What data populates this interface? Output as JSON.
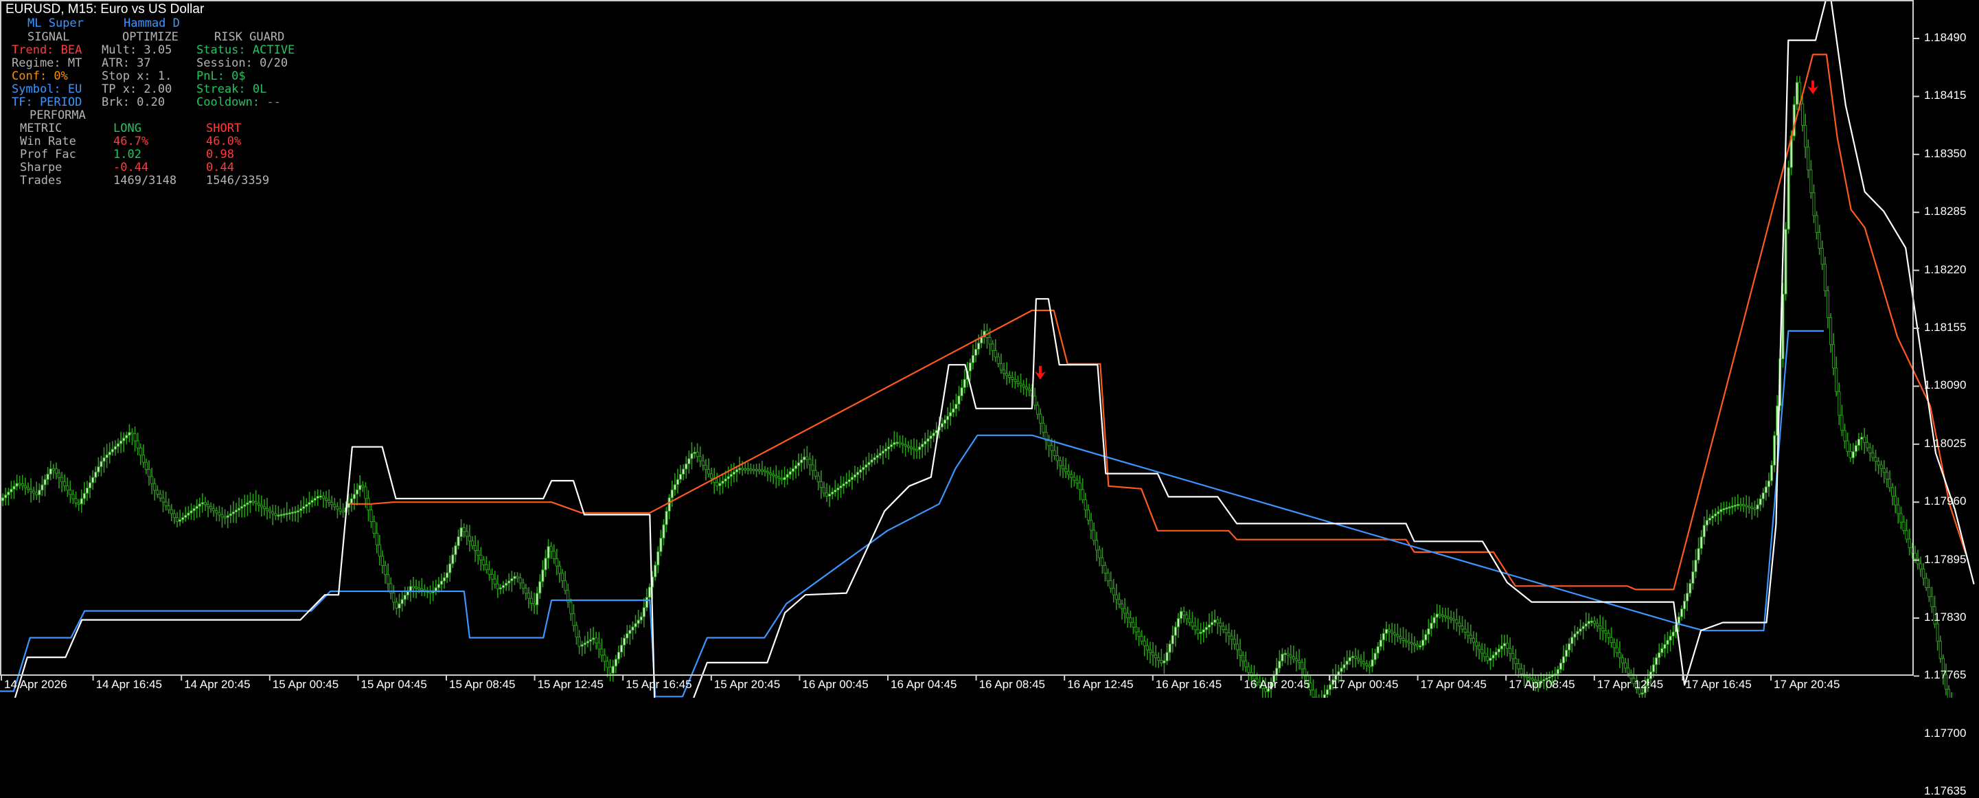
{
  "window": {
    "title": "EURUSD, M15:  Euro vs US Dollar"
  },
  "panel": {
    "header_left": "ML Super",
    "header_right": "Hammad D",
    "sections": [
      "SIGNAL",
      "OPTIMIZE",
      "RISK GUARD"
    ],
    "rows": [
      [
        "Trend: BEA",
        "Mult: 3.05",
        "Status: ACTIVE"
      ],
      [
        "Regime: MT",
        "ATR: 37",
        "Session: 0/20"
      ],
      [
        "Conf: 0%",
        "Stop x: 1.",
        "PnL: 0$"
      ],
      [
        "Symbol: EU",
        "TP x: 2.00",
        "Streak: 0L"
      ],
      [
        "TF: PERIOD",
        "Brk: 0.20",
        "Cooldown: --"
      ]
    ],
    "performance_title": "PERFORMA",
    "metrics_header": [
      "METRIC",
      "LONG",
      "SHORT"
    ],
    "metrics": [
      [
        "Win Rate",
        "46.7%",
        "46.0%"
      ],
      [
        "Prof Fac",
        "1.02",
        "0.98"
      ],
      [
        "Sharpe",
        "-0.44",
        "0.44"
      ],
      [
        "Trades",
        "1469/3148",
        "1546/3359"
      ]
    ]
  },
  "price_axis": [
    "1.18490",
    "1.18415",
    "1.18350",
    "1.18285",
    "1.18220",
    "1.18155",
    "1.18090",
    "1.18025",
    "1.17960",
    "1.17895",
    "1.17830",
    "1.17765",
    "1.17700",
    "1.17635"
  ],
  "time_axis": [
    "14 Apr 2026",
    "14 Apr 16:45",
    "14 Apr 20:45",
    "15 Apr 00:45",
    "15 Apr 04:45",
    "15 Apr 08:45",
    "15 Apr 12:45",
    "15 Apr 16:45",
    "15 Apr 20:45",
    "16 Apr 00:45",
    "16 Apr 04:45",
    "16 Apr 08:45",
    "16 Apr 12:45",
    "16 Apr 16:45",
    "16 Apr 20:45",
    "17 Apr 00:45",
    "17 Apr 04:45",
    "17 Apr 08:45",
    "17 Apr 12:45",
    "17 Apr 16:45",
    "17 Apr 20:45"
  ],
  "colors": {
    "background": "#000000",
    "candle": "#2a9a1a",
    "candle_body": "#c8f0c0",
    "band_white": "#ffffff",
    "band_orange": "#ff5a1e",
    "band_blue": "#3c96ff",
    "signal_arrow": "#ff1010",
    "text_blue": "#3c96ff",
    "text_gray": "#b4b4b4",
    "text_red": "#ff3b3b",
    "text_orange": "#ff8c00",
    "text_green": "#22c55e"
  },
  "series": {
    "price": [
      [
        0,
        1.1797
      ],
      [
        14,
        1.17992
      ],
      [
        28,
        1.17978
      ],
      [
        39,
        1.1801
      ],
      [
        58,
        1.17966
      ],
      [
        76,
        1.18018
      ],
      [
        97,
        1.1805
      ],
      [
        114,
        1.17984
      ],
      [
        131,
        1.17948
      ],
      [
        149,
        1.1797
      ],
      [
        165,
        1.17952
      ],
      [
        185,
        1.17972
      ],
      [
        203,
        1.17955
      ],
      [
        219,
        1.1796
      ],
      [
        235,
        1.17978
      ],
      [
        252,
        1.17958
      ],
      [
        266,
        1.17992
      ],
      [
        279,
        1.1791
      ],
      [
        291,
        1.1785
      ],
      [
        302,
        1.17876
      ],
      [
        317,
        1.17868
      ],
      [
        328,
        1.17888
      ],
      [
        339,
        1.17942
      ],
      [
        353,
        1.17906
      ],
      [
        366,
        1.17872
      ],
      [
        379,
        1.17888
      ],
      [
        392,
        1.17852
      ],
      [
        403,
        1.17922
      ],
      [
        414,
        1.17878
      ],
      [
        425,
        1.17808
      ],
      [
        436,
        1.17818
      ],
      [
        448,
        1.17778
      ],
      [
        459,
        1.1782
      ],
      [
        471,
        1.17842
      ],
      [
        480,
        1.17892
      ],
      [
        492,
        1.1798
      ],
      [
        509,
        1.18028
      ],
      [
        526,
        1.17988
      ],
      [
        542,
        1.18008
      ],
      [
        559,
        1.18006
      ],
      [
        574,
        1.17995
      ],
      [
        591,
        1.18022
      ],
      [
        606,
        1.17976
      ],
      [
        623,
        1.17995
      ],
      [
        640,
        1.18018
      ],
      [
        657,
        1.18038
      ],
      [
        672,
        1.18028
      ],
      [
        688,
        1.18052
      ],
      [
        701,
        1.18078
      ],
      [
        713,
        1.18132
      ],
      [
        722,
        1.18162
      ],
      [
        735,
        1.18116
      ],
      [
        746,
        1.18104
      ],
      [
        756,
        1.18094
      ],
      [
        767,
        1.1804
      ],
      [
        778,
        1.1801
      ],
      [
        791,
        1.1799
      ],
      [
        804,
        1.17918
      ],
      [
        816,
        1.17868
      ],
      [
        828,
        1.17838
      ],
      [
        841,
        1.17805
      ],
      [
        853,
        1.17788
      ],
      [
        866,
        1.17848
      ],
      [
        879,
        1.17822
      ],
      [
        891,
        1.17838
      ],
      [
        904,
        1.17815
      ],
      [
        916,
        1.17778
      ],
      [
        929,
        1.17756
      ],
      [
        941,
        1.17802
      ],
      [
        953,
        1.1779
      ],
      [
        966,
        1.1774
      ],
      [
        979,
        1.17775
      ],
      [
        991,
        1.17798
      ],
      [
        1004,
        1.17785
      ],
      [
        1016,
        1.17828
      ],
      [
        1029,
        1.17815
      ],
      [
        1041,
        1.17808
      ],
      [
        1053,
        1.17845
      ],
      [
        1066,
        1.17838
      ],
      [
        1078,
        1.17818
      ],
      [
        1091,
        1.17792
      ],
      [
        1103,
        1.17812
      ],
      [
        1116,
        1.17776
      ],
      [
        1128,
        1.17768
      ],
      [
        1141,
        1.17778
      ],
      [
        1153,
        1.1782
      ],
      [
        1166,
        1.17838
      ],
      [
        1178,
        1.17822
      ],
      [
        1191,
        1.17786
      ],
      [
        1203,
        1.17752
      ],
      [
        1215,
        1.17798
      ],
      [
        1227,
        1.17825
      ],
      [
        1238,
        1.17872
      ],
      [
        1250,
        1.17948
      ],
      [
        1262,
        1.17962
      ],
      [
        1275,
        1.17968
      ],
      [
        1287,
        1.17962
      ],
      [
        1298,
        1.17998
      ],
      [
        1304,
        1.18095
      ],
      [
        1311,
        1.18342
      ],
      [
        1317,
        1.18445
      ],
      [
        1323,
        1.18375
      ],
      [
        1330,
        1.18288
      ],
      [
        1336,
        1.18236
      ],
      [
        1342,
        1.18148
      ],
      [
        1349,
        1.18058
      ],
      [
        1356,
        1.18018
      ],
      [
        1364,
        1.18045
      ],
      [
        1372,
        1.18022
      ],
      [
        1382,
        1.18002
      ],
      [
        1392,
        1.17955
      ],
      [
        1400,
        1.17918
      ],
      [
        1408,
        1.17895
      ],
      [
        1416,
        1.17855
      ],
      [
        1424,
        1.1778
      ],
      [
        1432,
        1.17718
      ],
      [
        1440,
        1.177
      ],
      [
        1446,
        1.17648
      ]
    ],
    "band_white": [
      [
        0,
        1.17725
      ],
      [
        6,
        1.17725
      ],
      [
        20,
        1.17796
      ],
      [
        48,
        1.17796
      ],
      [
        60,
        1.17838
      ],
      [
        118,
        1.17838
      ],
      [
        220,
        1.17838
      ],
      [
        238,
        1.17866
      ],
      [
        248,
        1.17866
      ],
      [
        258,
        1.18032
      ],
      [
        280,
        1.18032
      ],
      [
        290,
        1.17974
      ],
      [
        340,
        1.17974
      ],
      [
        398,
        1.17974
      ],
      [
        404,
        1.17994
      ],
      [
        420,
        1.17994
      ],
      [
        428,
        1.17956
      ],
      [
        476,
        1.17956
      ],
      [
        480,
        1.17718
      ],
      [
        500,
        1.17718
      ],
      [
        518,
        1.1779
      ],
      [
        562,
        1.1779
      ],
      [
        575,
        1.17846
      ],
      [
        590,
        1.17866
      ],
      [
        620,
        1.17868
      ],
      [
        648,
        1.1796
      ],
      [
        666,
        1.17988
      ],
      [
        682,
        1.17998
      ],
      [
        695,
        1.18124
      ],
      [
        707,
        1.18124
      ],
      [
        715,
        1.18075
      ],
      [
        756,
        1.18075
      ],
      [
        759,
        1.18198
      ],
      [
        768,
        1.18198
      ],
      [
        776,
        1.18124
      ],
      [
        804,
        1.18124
      ],
      [
        810,
        1.18002
      ],
      [
        848,
        1.18002
      ],
      [
        856,
        1.17976
      ],
      [
        892,
        1.17976
      ],
      [
        906,
        1.17946
      ],
      [
        1030,
        1.17946
      ],
      [
        1036,
        1.17926
      ],
      [
        1086,
        1.17926
      ],
      [
        1104,
        1.1788
      ],
      [
        1122,
        1.17858
      ],
      [
        1226,
        1.17858
      ],
      [
        1234,
        1.17765
      ],
      [
        1246,
        1.17826
      ],
      [
        1262,
        1.17835
      ],
      [
        1294,
        1.17835
      ],
      [
        1301,
        1.17945
      ],
      [
        1310,
        1.18488
      ],
      [
        1330,
        1.18488
      ],
      [
        1340,
        1.18548
      ],
      [
        1352,
        1.18415
      ],
      [
        1366,
        1.18318
      ],
      [
        1380,
        1.18296
      ],
      [
        1396,
        1.18255
      ],
      [
        1418,
        1.18025
      ],
      [
        1432,
        1.17962
      ],
      [
        1446,
        1.17878
      ]
    ],
    "band_orange": [
      [
        256,
        1.17968
      ],
      [
        272,
        1.17968
      ],
      [
        288,
        1.1797
      ],
      [
        404,
        1.1797
      ],
      [
        426,
        1.17958
      ],
      [
        476,
        1.17958
      ],
      [
        756,
        1.18185
      ],
      [
        772,
        1.18185
      ],
      [
        782,
        1.18125
      ],
      [
        806,
        1.18125
      ],
      [
        812,
        1.17988
      ],
      [
        836,
        1.17985
      ],
      [
        848,
        1.17938
      ],
      [
        900,
        1.17938
      ],
      [
        906,
        1.17928
      ],
      [
        1030,
        1.17928
      ],
      [
        1036,
        1.17914
      ],
      [
        1094,
        1.17914
      ],
      [
        1110,
        1.17876
      ],
      [
        1192,
        1.17876
      ],
      [
        1198,
        1.17872
      ],
      [
        1226,
        1.17872
      ],
      [
        1328,
        1.18472
      ],
      [
        1338,
        1.18472
      ],
      [
        1346,
        1.18378
      ],
      [
        1356,
        1.18298
      ],
      [
        1366,
        1.18278
      ],
      [
        1390,
        1.18155
      ],
      [
        1414,
        1.18078
      ],
      [
        1428,
        1.17968
      ],
      [
        1440,
        1.17912
      ]
    ],
    "band_blue": [
      [
        0,
        1.17758
      ],
      [
        10,
        1.17758
      ],
      [
        22,
        1.17818
      ],
      [
        52,
        1.17818
      ],
      [
        62,
        1.17848
      ],
      [
        120,
        1.17848
      ],
      [
        228,
        1.17848
      ],
      [
        242,
        1.1787
      ],
      [
        284,
        1.1787
      ],
      [
        294,
        1.1787
      ],
      [
        340,
        1.1787
      ],
      [
        344,
        1.17818
      ],
      [
        398,
        1.17818
      ],
      [
        404,
        1.1786
      ],
      [
        420,
        1.1786
      ],
      [
        476,
        1.1786
      ],
      [
        480,
        1.17752
      ],
      [
        500,
        1.17752
      ],
      [
        518,
        1.17818
      ],
      [
        560,
        1.17818
      ],
      [
        576,
        1.17856
      ],
      [
        650,
        1.17938
      ],
      [
        688,
        1.17968
      ],
      [
        700,
        1.18008
      ],
      [
        716,
        1.18045
      ],
      [
        756,
        1.18045
      ],
      [
        1226,
        1.17835
      ],
      [
        1248,
        1.17826
      ],
      [
        1262,
        1.17826
      ],
      [
        1292,
        1.17826
      ],
      [
        1300,
        1.1797
      ],
      [
        1310,
        1.18162
      ],
      [
        1336,
        1.18162
      ]
    ],
    "arrows": [
      [
        762,
        1.18112
      ],
      [
        1328,
        1.18432
      ]
    ]
  }
}
